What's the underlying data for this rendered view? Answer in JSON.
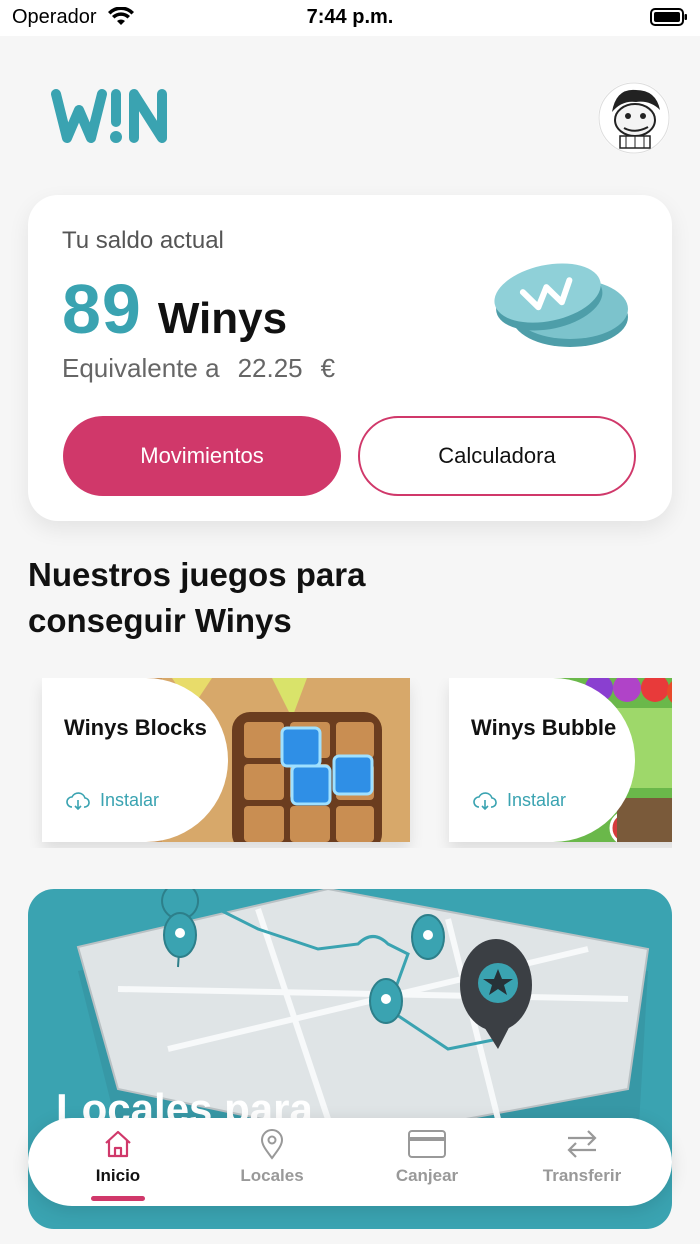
{
  "status_bar": {
    "carrier": "Operador",
    "time": "7:44 p.m."
  },
  "header": {
    "logo_text": "W!N",
    "brand_color": "#3aa3b1"
  },
  "balance": {
    "label": "Tu saldo actual",
    "value": "89",
    "unit": "Winys",
    "equiv_label": "Equivalente a",
    "equiv_value": "22.25",
    "currency": "€"
  },
  "actions": {
    "movements": "Movimientos",
    "calculator": "Calculadora"
  },
  "games_section": {
    "title": "Nuestros juegos para conseguir Winys",
    "games": [
      {
        "name": "Winys Blocks",
        "action": "Instalar"
      },
      {
        "name": "Winys Bubble",
        "action": "Instalar"
      }
    ]
  },
  "map_banner": {
    "title": "Locales para"
  },
  "nav": {
    "items": [
      {
        "label": "Inicio",
        "icon": "home-icon",
        "active": true
      },
      {
        "label": "Locales",
        "icon": "location-pin-icon",
        "active": false
      },
      {
        "label": "Canjear",
        "icon": "card-icon",
        "active": false
      },
      {
        "label": "Transferir",
        "icon": "transfer-arrows-icon",
        "active": false
      }
    ]
  },
  "colors": {
    "accent": "#3aa3b1",
    "primary_button": "#d0386a"
  }
}
